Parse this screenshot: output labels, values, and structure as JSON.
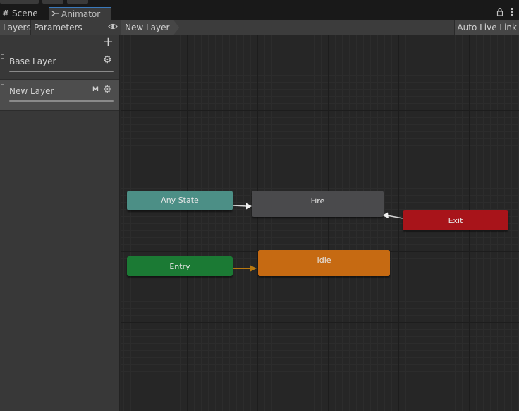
{
  "tabs": [
    {
      "label": "Scene",
      "icon": "grid-icon"
    },
    {
      "label": "Animator",
      "icon": "animator-icon"
    }
  ],
  "toolbar": {
    "layers_tab": "Layers",
    "parameters_tab": "Parameters",
    "breadcrumb": "New Layer",
    "auto_live_link": "Auto Live Link"
  },
  "sidebar": {
    "add_label": "+",
    "layers": [
      {
        "name": "Base Layer",
        "badge": ""
      },
      {
        "name": "New Layer",
        "badge": "M"
      }
    ]
  },
  "graph": {
    "states": [
      {
        "name": "Any State",
        "color": "#4c8f86"
      },
      {
        "name": "Fire",
        "color": "#4a4a4c"
      },
      {
        "name": "Exit",
        "color": "#a8141a"
      },
      {
        "name": "Entry",
        "color": "#1b7a34"
      },
      {
        "name": "Idle",
        "color": "#c66a12"
      }
    ]
  },
  "colors": {
    "accent": "#3a79bb",
    "transition": "#d4d4d4",
    "entry_transition": "#b9790f"
  }
}
